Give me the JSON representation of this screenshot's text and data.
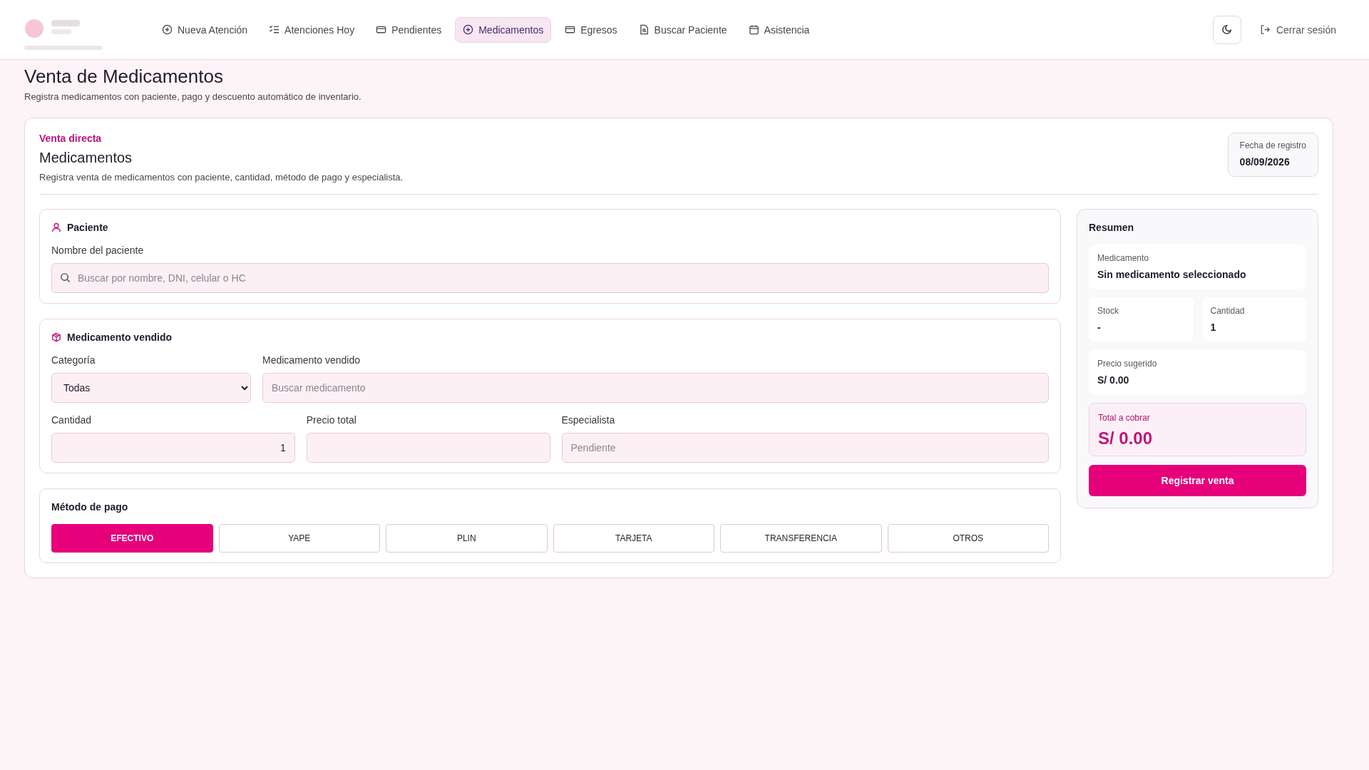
{
  "header": {
    "nav": [
      {
        "label": "Nueva Atención",
        "selected": false
      },
      {
        "label": "Atenciones Hoy",
        "selected": false
      },
      {
        "label": "Pendientes",
        "selected": false
      },
      {
        "label": "Medicamentos",
        "selected": true
      },
      {
        "label": "Egresos",
        "selected": false
      },
      {
        "label": "Buscar Paciente",
        "selected": false
      },
      {
        "label": "Asistencia",
        "selected": false
      }
    ],
    "logout": "Cerrar sesión"
  },
  "page": {
    "title": "Venta de Medicamentos",
    "subtitle": "Registra medicamentos con paciente, pago y descuento automático de inventario."
  },
  "card": {
    "eyebrow": "Venta directa",
    "title": "Medicamentos",
    "description": "Registra venta de medicamentos con paciente, cantidad, método de pago y especialista.",
    "date": {
      "label": "Fecha de registro",
      "value": "08/09/2026"
    }
  },
  "patient": {
    "title": "Paciente",
    "field_label": "Nombre del paciente",
    "placeholder": "Buscar por nombre, DNI, celular o HC"
  },
  "medication": {
    "title": "Medicamento vendido",
    "category": {
      "label": "Categoría",
      "value": "Todas"
    },
    "product": {
      "label": "Medicamento vendido",
      "placeholder": "Buscar medicamento"
    },
    "quantity": {
      "label": "Cantidad",
      "value": "1"
    },
    "total_price": {
      "label": "Precio total"
    },
    "specialist": {
      "label": "Especialista",
      "placeholder": "Pendiente"
    }
  },
  "payment": {
    "title": "Método de pago",
    "methods": [
      {
        "label": "EFECTIVO",
        "selected": true
      },
      {
        "label": "YAPE",
        "selected": false
      },
      {
        "label": "PLIN",
        "selected": false
      },
      {
        "label": "TARJETA",
        "selected": false
      },
      {
        "label": "TRANSFERENCIA",
        "selected": false
      },
      {
        "label": "OTROS",
        "selected": false
      }
    ]
  },
  "summary": {
    "title": "Resumen",
    "items": [
      {
        "label": "Medicamento",
        "value": "Sin medicamento seleccionado"
      },
      {
        "label": "Stock",
        "value": "-"
      },
      {
        "label": "Cantidad",
        "value": "1"
      },
      {
        "label": "Precio sugerido",
        "value": "S/ 0.00"
      }
    ],
    "total": {
      "label": "Total a cobrar",
      "value": "S/ 0.00"
    },
    "submit": "Registrar venta"
  }
}
